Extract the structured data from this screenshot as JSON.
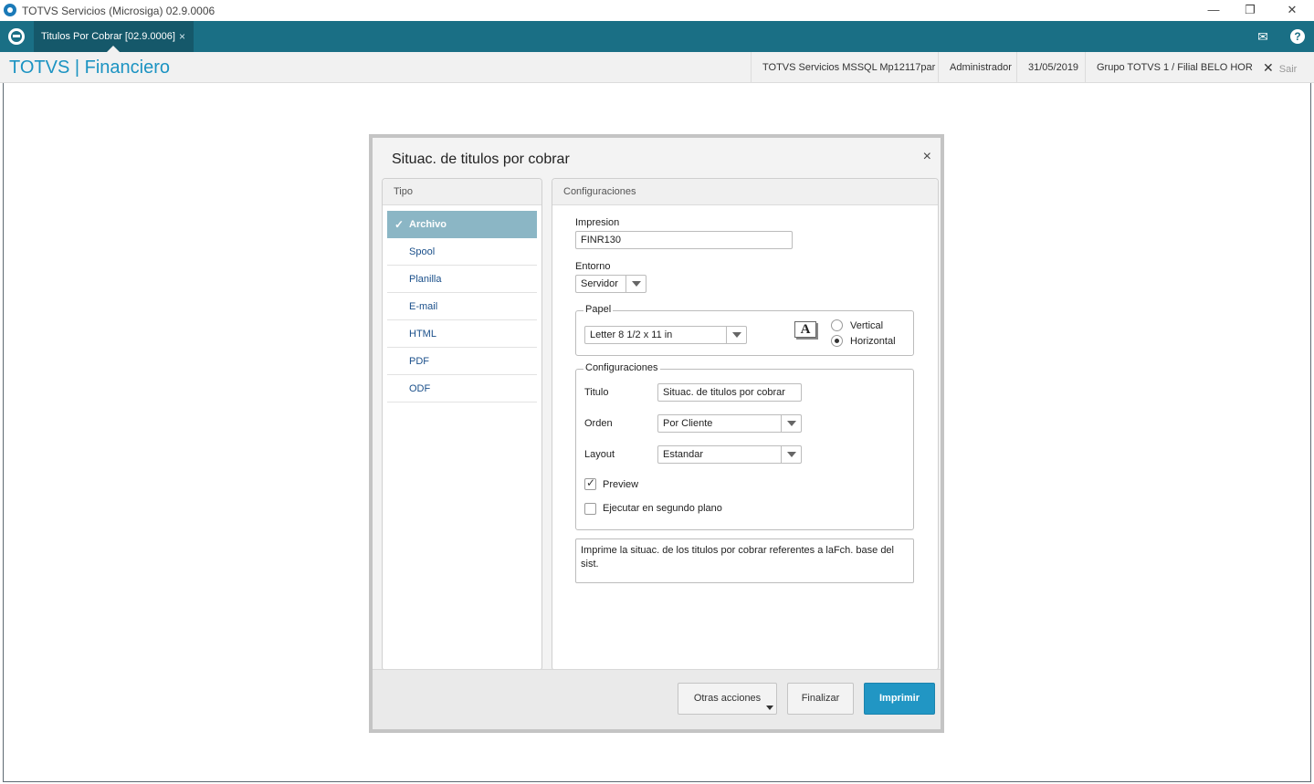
{
  "window": {
    "title": "TOTVS Servicios (Microsiga) 02.9.0006",
    "controls": {
      "minimize": "—",
      "restore": "❐",
      "close": "✕"
    }
  },
  "tabbar": {
    "tab_label": "Titulos Por Cobrar [02.9.0006]",
    "tab_close": "×",
    "mail_icon": "✉",
    "help_icon": "?"
  },
  "header": {
    "brand": "TOTVS | Financiero",
    "environment": "TOTVS Servicios MSSQL Mp12117par",
    "user": "Administrador",
    "date": "31/05/2019",
    "branch": "Grupo TOTVS 1 / Filial BELO HOR",
    "exit_icon": "✕",
    "exit_label": "Sair"
  },
  "dialog": {
    "title": "Situac. de titulos por cobrar",
    "close": "×",
    "tipo": {
      "header": "Tipo",
      "check": "✓",
      "items": [
        {
          "label": "Archivo",
          "selected": true
        },
        {
          "label": "Spool"
        },
        {
          "label": "Planilla"
        },
        {
          "label": "E-mail"
        },
        {
          "label": "HTML"
        },
        {
          "label": "PDF"
        },
        {
          "label": "ODF"
        }
      ]
    },
    "config": {
      "header": "Configuraciones",
      "impresion_label": "Impresion",
      "impresion_value": "FINR130",
      "entorno_label": "Entorno",
      "entorno_value": "Servidor",
      "papel": {
        "legend": "Papel",
        "size": "Letter 8 1/2 x 11 in",
        "font_icon": "A",
        "vertical": "Vertical",
        "horizontal": "Horizontal",
        "orientation": "Horizontal"
      },
      "settings": {
        "legend": "Configuraciones",
        "titulo_label": "Titulo",
        "titulo_value": "Situac. de titulos por cobrar",
        "orden_label": "Orden",
        "orden_value": "Por Cliente",
        "layout_label": "Layout",
        "layout_value": "Estandar",
        "preview_label": "Preview",
        "preview_checked": true,
        "background_label": "Ejecutar en segundo plano",
        "background_checked": false
      },
      "description": "Imprime la situac. de los titulos por cobrar referentes a laFch. base del sist."
    },
    "buttons": {
      "other": "Otras acciones",
      "finish": "Finalizar",
      "print": "Imprimir"
    }
  },
  "colors": {
    "tabbar": "#1a6f85",
    "brand": "#1b93c2",
    "selected_item": "#8bb6c5",
    "primary_button": "#2196c4"
  }
}
